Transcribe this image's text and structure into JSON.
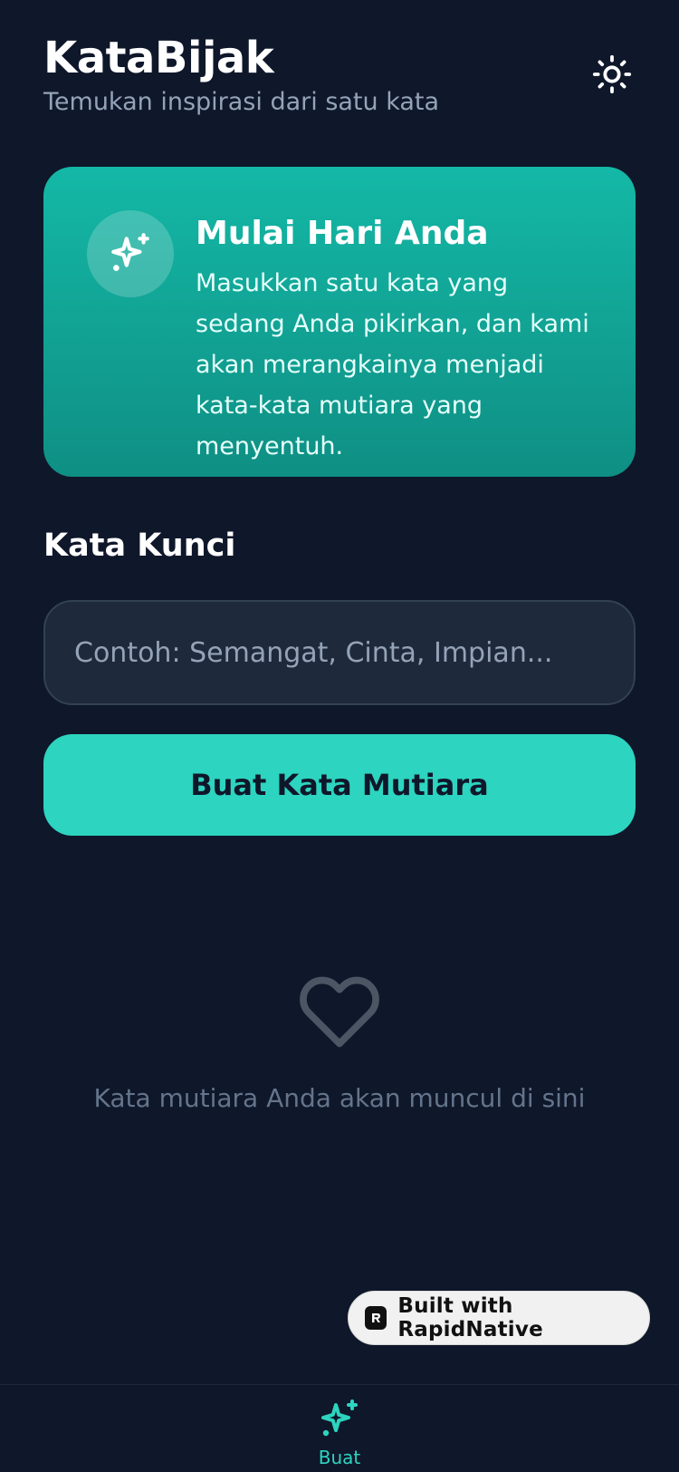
{
  "header": {
    "title": "KataBijak",
    "subtitle": "Temukan inspirasi dari satu kata",
    "theme_toggle_icon": "sun-icon"
  },
  "hero": {
    "icon": "sparkles-icon",
    "title": "Mulai Hari Anda",
    "body": "Masukkan satu kata yang sedang Anda pikirkan, dan kami akan merangkainya menjadi kata-kata mutiara yang menyentuh."
  },
  "keyword": {
    "label": "Kata Kunci",
    "value": "",
    "placeholder": "Contoh: Semangat, Cinta, Impian..."
  },
  "generate_button": {
    "label": "Buat Kata Mutiara"
  },
  "empty_state": {
    "icon": "heart-icon",
    "text": "Kata mutiara Anda akan muncul di sini"
  },
  "badge": {
    "label": "Built with RapidNative"
  },
  "tab_bar": {
    "tabs": [
      {
        "label": "Buat",
        "icon": "sparkles-icon",
        "active": true
      }
    ]
  },
  "colors": {
    "background": "#0f172a",
    "accent": "#2dd4bf",
    "card_gradient_top": "#14b8a6",
    "card_gradient_bottom": "#0f8f84",
    "input_bg": "#1e293b",
    "muted_text": "#94a3b8"
  }
}
